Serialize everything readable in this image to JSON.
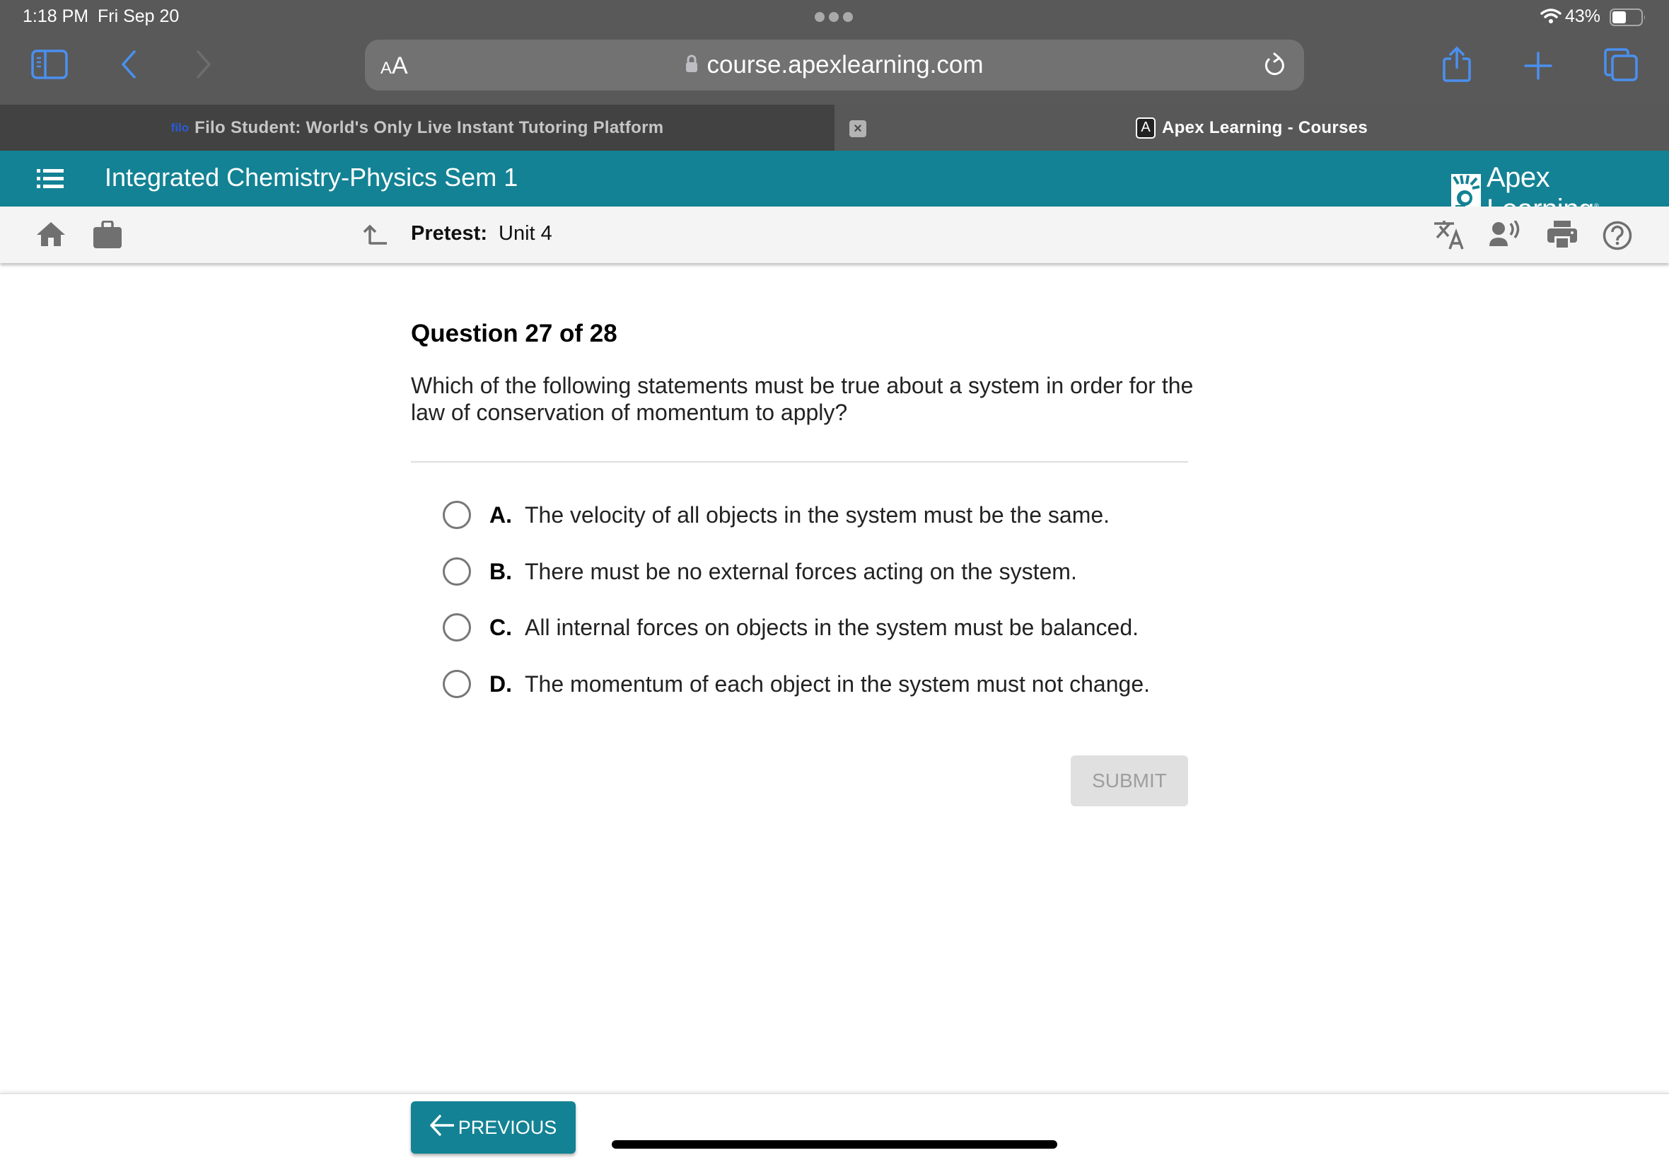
{
  "status_bar": {
    "time": "1:18 PM",
    "date": "Fri Sep 20",
    "battery_percent": "43%",
    "battery_level": 0.43,
    "wifi_icon": "wifi-icon"
  },
  "browser": {
    "text_size_label_small": "A",
    "text_size_label_large": "A",
    "url": "course.apexlearning.com",
    "icons": [
      "sidebar-icon",
      "back-icon",
      "forward-icon",
      "lock-icon",
      "reload-icon",
      "share-icon",
      "new-tab-icon",
      "tabs-icon"
    ],
    "accent_color": "#4a90f0",
    "tabs": [
      {
        "favicon": "filo",
        "label": "Filo Student: World's Only Live Instant Tutoring Platform",
        "active": false
      },
      {
        "favicon": "A",
        "label": "Apex Learning - Courses",
        "active": true
      }
    ],
    "close_tab_label": "×"
  },
  "header": {
    "course_title": "Integrated Chemistry-Physics Sem 1",
    "logo_text": "Apex Learning",
    "logo_mark": "®",
    "brand_color": "#138294"
  },
  "activity_bar": {
    "breadcrumb_label": "Pretest:",
    "breadcrumb_value": "Unit 4",
    "icons": [
      "home-icon",
      "briefcase-icon",
      "up-arrow-icon",
      "translate-icon",
      "text-to-speech-icon",
      "print-icon",
      "help-icon"
    ]
  },
  "question": {
    "title": "Question 27 of 28",
    "text": "Which of the following statements must be true about a system in order for the law of conservation of momentum to apply?",
    "options": [
      {
        "letter": "A.",
        "text": "The velocity of all objects in the system must be the same.",
        "selected": false
      },
      {
        "letter": "B.",
        "text": "There must be no external forces acting on the system.",
        "selected": false
      },
      {
        "letter": "C.",
        "text": "All internal forces on objects in the system must be balanced.",
        "selected": false
      },
      {
        "letter": "D.",
        "text": "The momentum of each object in the system must not change.",
        "selected": false
      }
    ],
    "submit_label": "SUBMIT"
  },
  "footer": {
    "previous_label": "PREVIOUS"
  }
}
